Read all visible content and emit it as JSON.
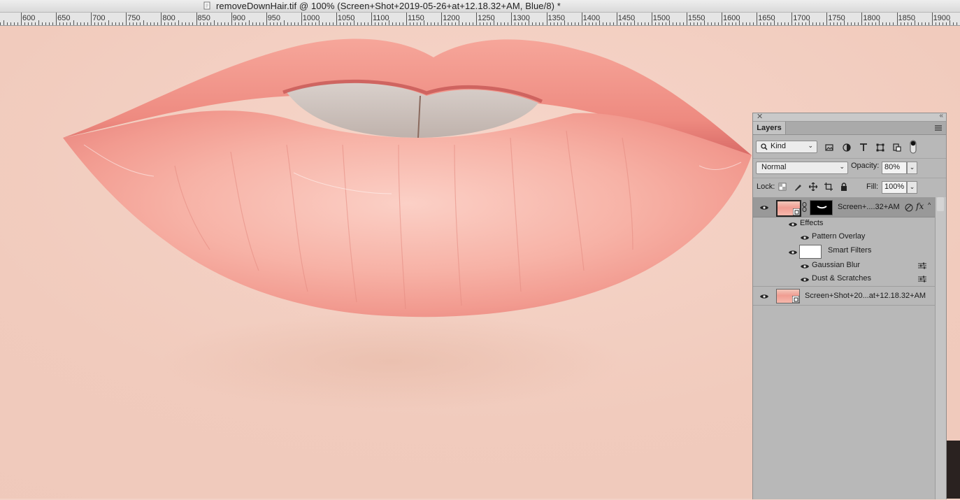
{
  "window": {
    "title": "removeDownHair.tif @ 100% (Screen+Shot+2019-05-26+at+12.18.32+AM, Blue/8) *"
  },
  "ruler": {
    "ticks": [
      "600",
      "650",
      "700",
      "750",
      "800",
      "850",
      "900",
      "950",
      "1000",
      "1050",
      "1100",
      "1150",
      "1200",
      "1250",
      "1300",
      "1350",
      "1400",
      "1450",
      "1500",
      "1550",
      "1600",
      "1650",
      "1700",
      "1750",
      "1800",
      "1850",
      "1900"
    ]
  },
  "canvas": {
    "content": "close-up photo of lips"
  },
  "layers_panel": {
    "tab_label": "Layers",
    "filter_kind": "Kind",
    "blend_mode": "Normal",
    "opacity_label": "Opacity:",
    "opacity_value": "80%",
    "lock_label": "Lock:",
    "fill_label": "Fill:",
    "fill_value": "100%",
    "layers": [
      {
        "name": "Screen+....32+AM",
        "selected": true
      },
      {
        "name": "Screen+Shot+20...at+12.18.32+AM",
        "selected": false
      }
    ],
    "effects_label": "Effects",
    "pattern_overlay_label": "Pattern Overlay",
    "smart_filters_label": "Smart Filters",
    "gaussian_blur_label": "Gaussian Blur",
    "dust_scratches_label": "Dust & Scratches"
  },
  "colors": {
    "panel_bg": "#b8b8b8",
    "selected_row": "#9a9a9a",
    "skin": "#f3d2c6",
    "lip": "#f29a90"
  }
}
